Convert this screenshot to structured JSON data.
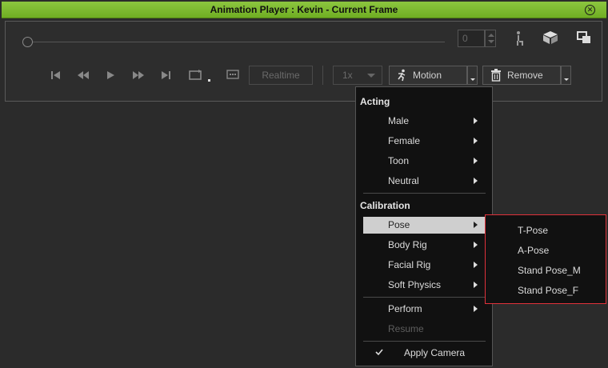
{
  "window": {
    "title": "Animation Player : Kevin - Current Frame",
    "close_icon": "close-circle-icon"
  },
  "player": {
    "frame_value": "0",
    "realtime_label": "Realtime",
    "speed_value": "1x",
    "motion_label": "Motion",
    "remove_label": "Remove",
    "progress": 0
  },
  "menu": {
    "sections": [
      {
        "heading": "Acting",
        "items": [
          {
            "label": "Male",
            "submenu": true
          },
          {
            "label": "Female",
            "submenu": true
          },
          {
            "label": "Toon",
            "submenu": true
          },
          {
            "label": "Neutral",
            "submenu": true
          }
        ]
      },
      {
        "heading": "Calibration",
        "items": [
          {
            "label": "Pose",
            "submenu": true,
            "highlighted": true
          },
          {
            "label": "Body Rig",
            "submenu": true
          },
          {
            "label": "Facial Rig",
            "submenu": true
          },
          {
            "label": "Soft Physics",
            "submenu": true
          }
        ]
      }
    ],
    "perform_label": "Perform",
    "resume_label": "Resume",
    "apply_camera_label": "Apply Camera",
    "apply_camera_checked": true
  },
  "submenu": {
    "items": [
      "T-Pose",
      "A-Pose",
      "Stand Pose_M",
      "Stand Pose_F"
    ],
    "border_color": "#e0313a"
  },
  "colors": {
    "title_bar": "#7cbb2f",
    "background": "#2b2b2b",
    "menu_background": "#111111",
    "menu_highlight": "#cfcfcf"
  }
}
